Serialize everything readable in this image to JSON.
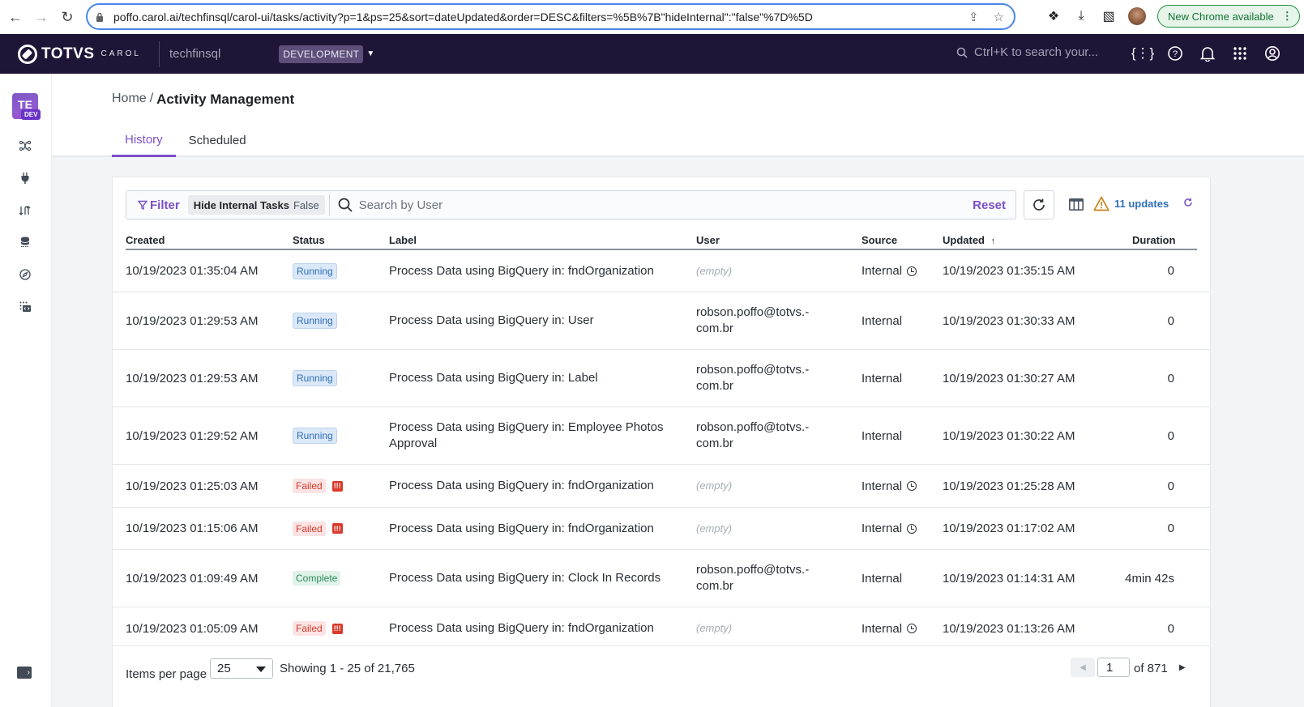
{
  "browser": {
    "url": "poffo.carol.ai/techfinsql/carol-ui/tasks/activity?p=1&ps=25&sort=dateUpdated&order=DESC&filters=%5B%7B\"hideInternal\":\"false\"%7D%5D",
    "new_chrome_label": "New Chrome available"
  },
  "header": {
    "brand": "TOTVS",
    "brand_sub": "CAROL",
    "tenant": "techfinsql",
    "environment": "DEVELOPMENT",
    "search_placeholder": "Ctrl+K to search your..."
  },
  "sidebar": {
    "workspace_initials": "TE",
    "workspace_badge": "DEV",
    "items": [
      {
        "icon": "pipeline-icon"
      },
      {
        "icon": "connector-plug-icon"
      },
      {
        "icon": "data-flow-icon"
      },
      {
        "icon": "database-icon"
      },
      {
        "icon": "explore-compass-icon"
      },
      {
        "icon": "apps-code-icon"
      }
    ]
  },
  "page": {
    "breadcrumb_home": "Home",
    "breadcrumb_sep": "/",
    "title": "Activity Management",
    "tabs": [
      {
        "label": "History",
        "active": true
      },
      {
        "label": "Scheduled",
        "active": false
      }
    ]
  },
  "toolbar": {
    "filter_label": "Filter",
    "chip_key": "Hide Internal Tasks",
    "chip_value": "False",
    "search_placeholder": "Search by User",
    "search_value": "",
    "reset_label": "Reset",
    "updates_label": "11 updates"
  },
  "table": {
    "columns": [
      "Created",
      "Status",
      "Label",
      "User",
      "Source",
      "Updated",
      "Duration"
    ],
    "sort_column": "Updated",
    "rows": [
      {
        "created": "10/19/2023 01:35:04 AM",
        "status": "Running",
        "label": "Process Data using BigQuery in: fndOrganization",
        "user": "(empty)",
        "source": "Internal",
        "scheduled": true,
        "updated": "10/19/2023 01:35:15 AM",
        "duration": "0"
      },
      {
        "created": "10/19/2023 01:29:53 AM",
        "status": "Running",
        "label": "Process Data using BigQuery in: User",
        "user": "robson.poffo@totvs.-com.br",
        "source": "Internal",
        "scheduled": false,
        "updated": "10/19/2023 01:30:33 AM",
        "duration": "0"
      },
      {
        "created": "10/19/2023 01:29:53 AM",
        "status": "Running",
        "label": "Process Data using BigQuery in: Label",
        "user": "robson.poffo@totvs.-com.br",
        "source": "Internal",
        "scheduled": false,
        "updated": "10/19/2023 01:30:27 AM",
        "duration": "0"
      },
      {
        "created": "10/19/2023 01:29:52 AM",
        "status": "Running",
        "label": "Process Data using BigQuery in: Employee Photos Approval",
        "user": "robson.poffo@totvs.-com.br",
        "source": "Internal",
        "scheduled": false,
        "updated": "10/19/2023 01:30:22 AM",
        "duration": "0"
      },
      {
        "created": "10/19/2023 01:25:03 AM",
        "status": "Failed",
        "label": "Process Data using BigQuery in: fndOrganization",
        "user": "(empty)",
        "source": "Internal",
        "scheduled": true,
        "updated": "10/19/2023 01:25:28 AM",
        "duration": "0"
      },
      {
        "created": "10/19/2023 01:15:06 AM",
        "status": "Failed",
        "label": "Process Data using BigQuery in: fndOrganization",
        "user": "(empty)",
        "source": "Internal",
        "scheduled": true,
        "updated": "10/19/2023 01:17:02 AM",
        "duration": "0"
      },
      {
        "created": "10/19/2023 01:09:49 AM",
        "status": "Complete",
        "label": "Process Data using BigQuery in: Clock In Records",
        "user": "robson.poffo@totvs.-com.br",
        "source": "Internal",
        "scheduled": false,
        "updated": "10/19/2023 01:14:31 AM",
        "duration": "4min 42s"
      },
      {
        "created": "10/19/2023 01:05:09 AM",
        "status": "Failed",
        "label": "Process Data using BigQuery in: fndOrganization",
        "user": "(empty)",
        "source": "Internal",
        "scheduled": true,
        "updated": "10/19/2023 01:13:26 AM",
        "duration": "0"
      }
    ]
  },
  "pagination": {
    "items_per_page_label": "Items per page",
    "items_per_page": "25",
    "showing": "Showing 1 - 25 of 21,765",
    "current_page": "1",
    "of_pages": "of 871"
  },
  "colors": {
    "accent": "#7b4fc9",
    "header_bg": "#1f1537",
    "running": "#2f6fba",
    "failed": "#d93a2b",
    "complete": "#2a8a5c"
  }
}
